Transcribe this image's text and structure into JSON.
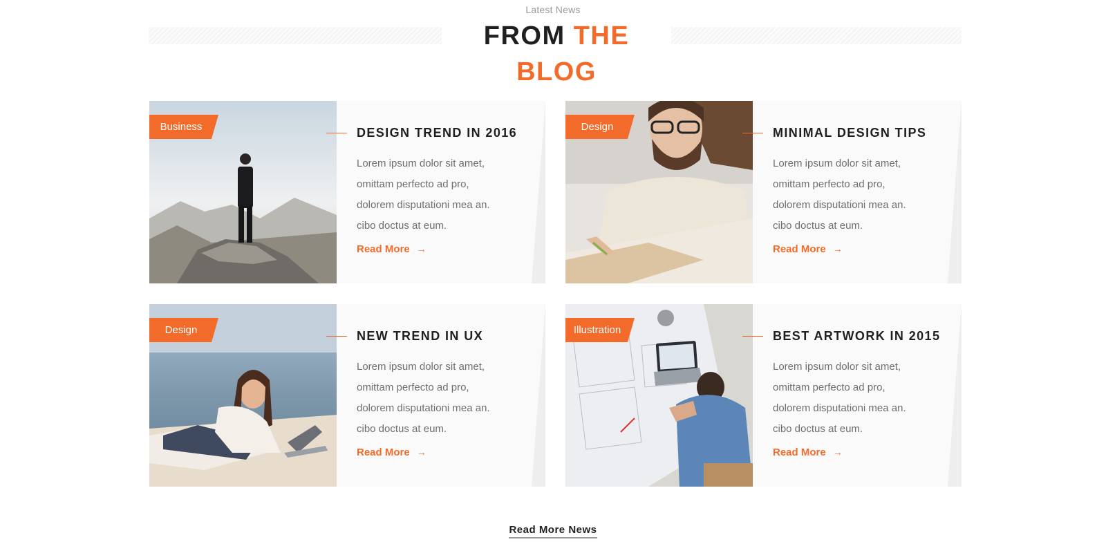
{
  "section": {
    "kicker": "Latest News",
    "title_plain": "FROM",
    "title_accent": "THE BLOG"
  },
  "colors": {
    "accent": "#f26b2a",
    "heading": "#1f1f1f",
    "body_text": "#6e6e6e",
    "card_bg": "#fafafa"
  },
  "posts": [
    {
      "tag": "Business",
      "title": "DESIGN TREND IN 2016",
      "excerpt": [
        "Lorem ipsum dolor sit amet,",
        "omittam perfecto ad pro,",
        "dolorem disputationi mea an.",
        "cibo doctus at eum."
      ],
      "read_more": "Read More",
      "arrow": "→"
    },
    {
      "tag": "Design",
      "title": "MINIMAL DESIGN TIPS",
      "excerpt": [
        "Lorem ipsum dolor sit amet,",
        "omittam perfecto ad pro,",
        "dolorem disputationi mea an.",
        "cibo doctus at eum."
      ],
      "read_more": "Read More",
      "arrow": "→"
    },
    {
      "tag": "Design",
      "title": "NEW TREND IN UX",
      "excerpt": [
        "Lorem ipsum dolor sit amet,",
        "omittam perfecto ad pro,",
        "dolorem disputationi mea an.",
        "cibo doctus at eum."
      ],
      "read_more": "Read More",
      "arrow": "→"
    },
    {
      "tag": "Illustration",
      "title": "BEST ARTWORK IN 2015",
      "excerpt": [
        "Lorem ipsum dolor sit amet,",
        "omittam perfecto ad pro,",
        "dolorem disputationi mea an.",
        "cibo doctus at eum."
      ],
      "read_more": "Read More",
      "arrow": "→"
    }
  ],
  "footer": {
    "read_more_news": "Read More News"
  }
}
